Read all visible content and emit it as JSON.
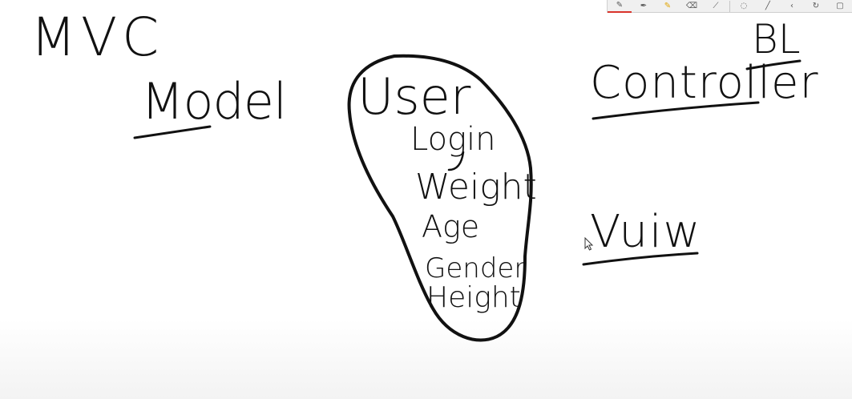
{
  "board": {
    "title": "MVC",
    "model_label": "Model",
    "user_label": "User",
    "user_fields": [
      "Login",
      "Weight",
      "Age",
      "Gender",
      "Height"
    ],
    "controller_label": "Controller",
    "controller_note": "BL",
    "view_label": "Vuiw"
  },
  "toolbar": {
    "tools": [
      {
        "name": "pen-icon",
        "glyph": "✎",
        "active": true
      },
      {
        "name": "pen-alt-icon",
        "glyph": "✒",
        "active": false
      },
      {
        "name": "highlighter-icon",
        "glyph": "✎",
        "active": false
      },
      {
        "name": "eraser-icon",
        "glyph": "⌫",
        "active": false
      },
      {
        "name": "ruler-icon",
        "glyph": "⟋",
        "active": false
      },
      {
        "name": "lasso-icon",
        "glyph": "◌",
        "active": false
      },
      {
        "name": "line-icon",
        "glyph": "╱",
        "active": false
      },
      {
        "name": "arrow-icon",
        "glyph": "‹",
        "active": false
      },
      {
        "name": "rotate-icon",
        "glyph": "↻",
        "active": false
      },
      {
        "name": "page-icon",
        "glyph": "▢",
        "active": false
      }
    ]
  },
  "colors": {
    "ink": "#111111",
    "active_tool_underline": "#d9342b",
    "highlighter": "#e0a400"
  }
}
